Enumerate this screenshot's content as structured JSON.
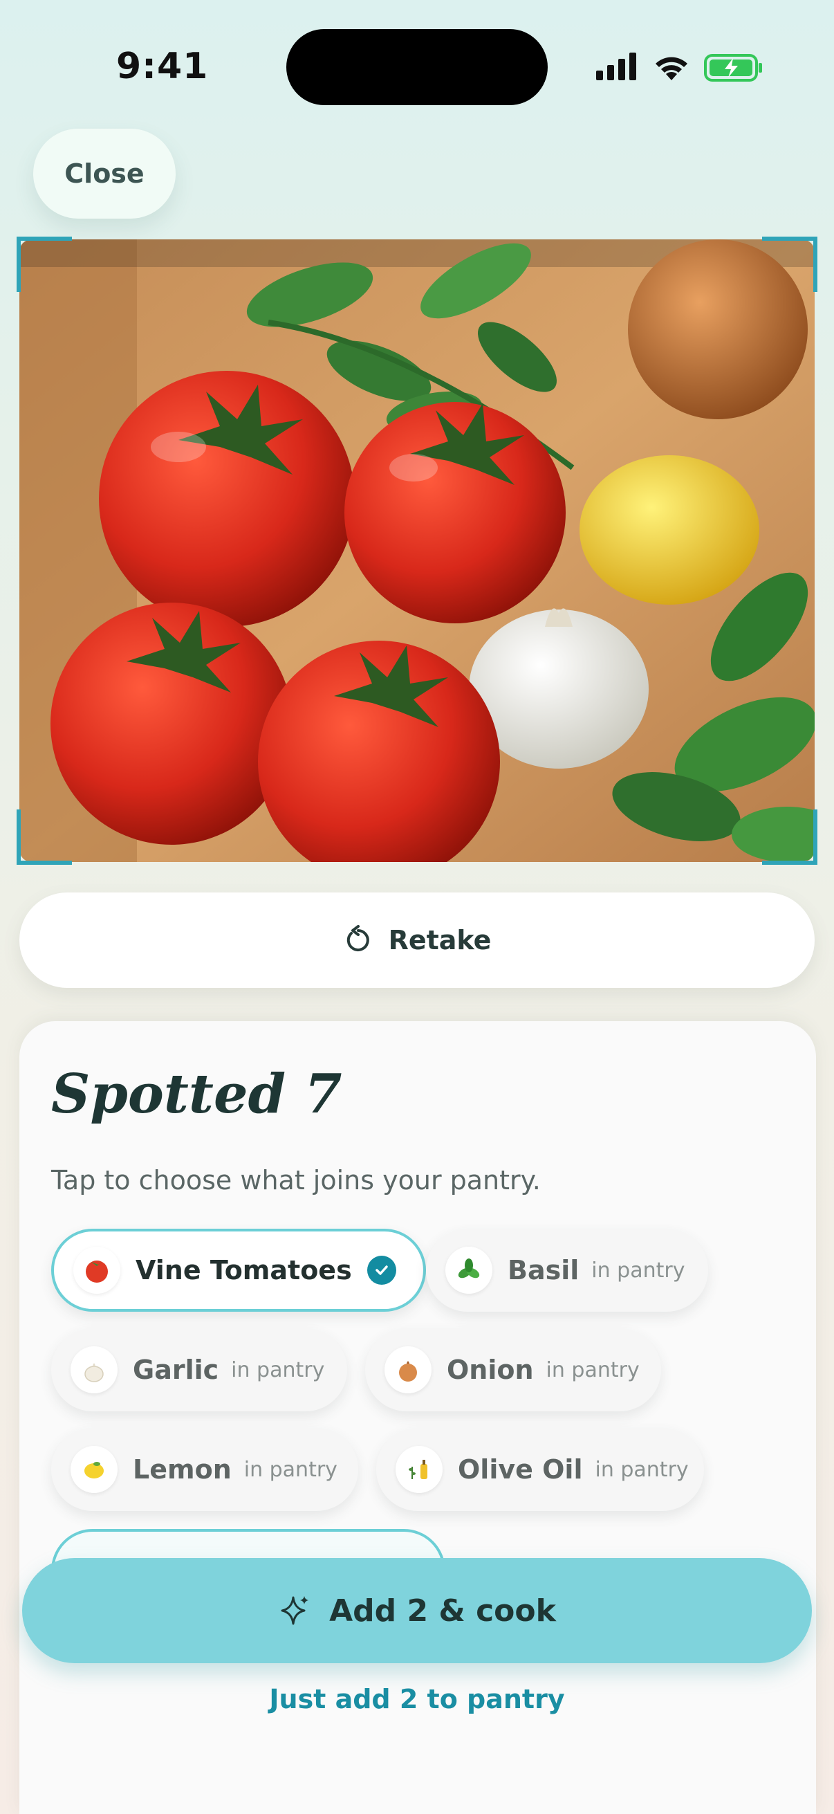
{
  "status_bar": {
    "time": "9:41"
  },
  "header": {
    "close_label": "Close"
  },
  "retake": {
    "label": "Retake"
  },
  "results": {
    "title": "Spotted 7",
    "subtitle": "Tap to choose what joins your pantry.",
    "chips": [
      {
        "label": "Vine Tomatoes",
        "tag": "",
        "selected": true,
        "icon": "tomato-icon"
      },
      {
        "label": "Basil",
        "tag": "in pantry",
        "selected": false,
        "icon": "basil-icon"
      },
      {
        "label": "Garlic",
        "tag": "in pantry",
        "selected": false,
        "icon": "garlic-icon"
      },
      {
        "label": "Onion",
        "tag": "in pantry",
        "selected": false,
        "icon": "onion-icon"
      },
      {
        "label": "Lemon",
        "tag": "in pantry",
        "selected": false,
        "icon": "lemon-icon"
      },
      {
        "label": "Olive Oil",
        "tag": "in pantry",
        "selected": false,
        "icon": "olive-oil-icon"
      }
    ]
  },
  "actions": {
    "primary_label": "Add 2 & cook",
    "secondary_label": "Just add 2 to pantry"
  },
  "colors": {
    "accent": "#7fd3dc",
    "accent_dark": "#1a8ea3",
    "selected_border": "#6ccfd6",
    "check": "#138ca1",
    "battery": "#34c759"
  }
}
